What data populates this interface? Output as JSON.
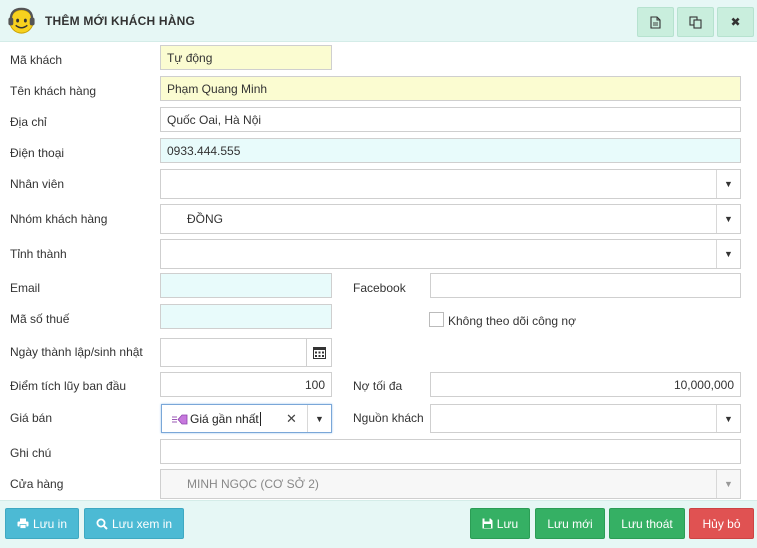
{
  "header": {
    "title": "THÊM MỚI KHÁCH HÀNG",
    "buttons": [
      "document-icon",
      "copy-icon",
      "close-icon"
    ],
    "close_label": "✖"
  },
  "form": {
    "ma_khach": {
      "label": "Mã khách",
      "value": "Tự động"
    },
    "ten_khach_hang": {
      "label": "Tên khách hàng",
      "value": "Phạm Quang Minh"
    },
    "dia_chi": {
      "label": "Địa chỉ",
      "value": "Quốc Oai, Hà Nội"
    },
    "dien_thoai": {
      "label": "Điện thoại",
      "value": "0933.444.555"
    },
    "nhan_vien": {
      "label": "Nhân viên",
      "value": ""
    },
    "nhom_khach_hang": {
      "label": "Nhóm khách hàng",
      "value": "ĐỒNG"
    },
    "tinh_thanh": {
      "label": "Tỉnh thành",
      "value": ""
    },
    "email": {
      "label": "Email",
      "value": ""
    },
    "facebook": {
      "label": "Facebook",
      "value": ""
    },
    "ma_so_thue": {
      "label": "Mã số thuế",
      "value": ""
    },
    "khong_theo_doi": {
      "label": "Không theo dõi công nợ",
      "checked": false
    },
    "ngay_thanh_lap": {
      "label": "Ngày thành lập/sinh nhật",
      "value": ""
    },
    "diem_tich_luy": {
      "label": "Điểm tích lũy ban đầu",
      "value": "100"
    },
    "no_toi_da": {
      "label": "Nợ tối đa",
      "value": "10,000,000"
    },
    "gia_ban": {
      "label": "Giá bán",
      "value": "Giá gần nhất"
    },
    "nguon_khach": {
      "label": "Nguồn khách",
      "value": ""
    },
    "ghi_chu": {
      "label": "Ghi chú",
      "value": ""
    },
    "cua_hang": {
      "label": "Cửa hàng",
      "value": "MINH NGỌC (CƠ SỞ 2)"
    }
  },
  "footer": {
    "luu_in": "Lưu in",
    "luu_xem_in": "Lưu xem in",
    "luu": "Lưu",
    "luu_moi": "Lưu mới",
    "luu_thoat": "Lưu thoát",
    "huy_bo": "Hủy bỏ"
  },
  "colors": {
    "header_bg": "#e6f7f5",
    "yellow_field": "#fbfcd1",
    "cyan_field": "#e8fbfb",
    "blue_button": "#4cbad4",
    "green_button": "#35b064",
    "red_button": "#e05252"
  }
}
